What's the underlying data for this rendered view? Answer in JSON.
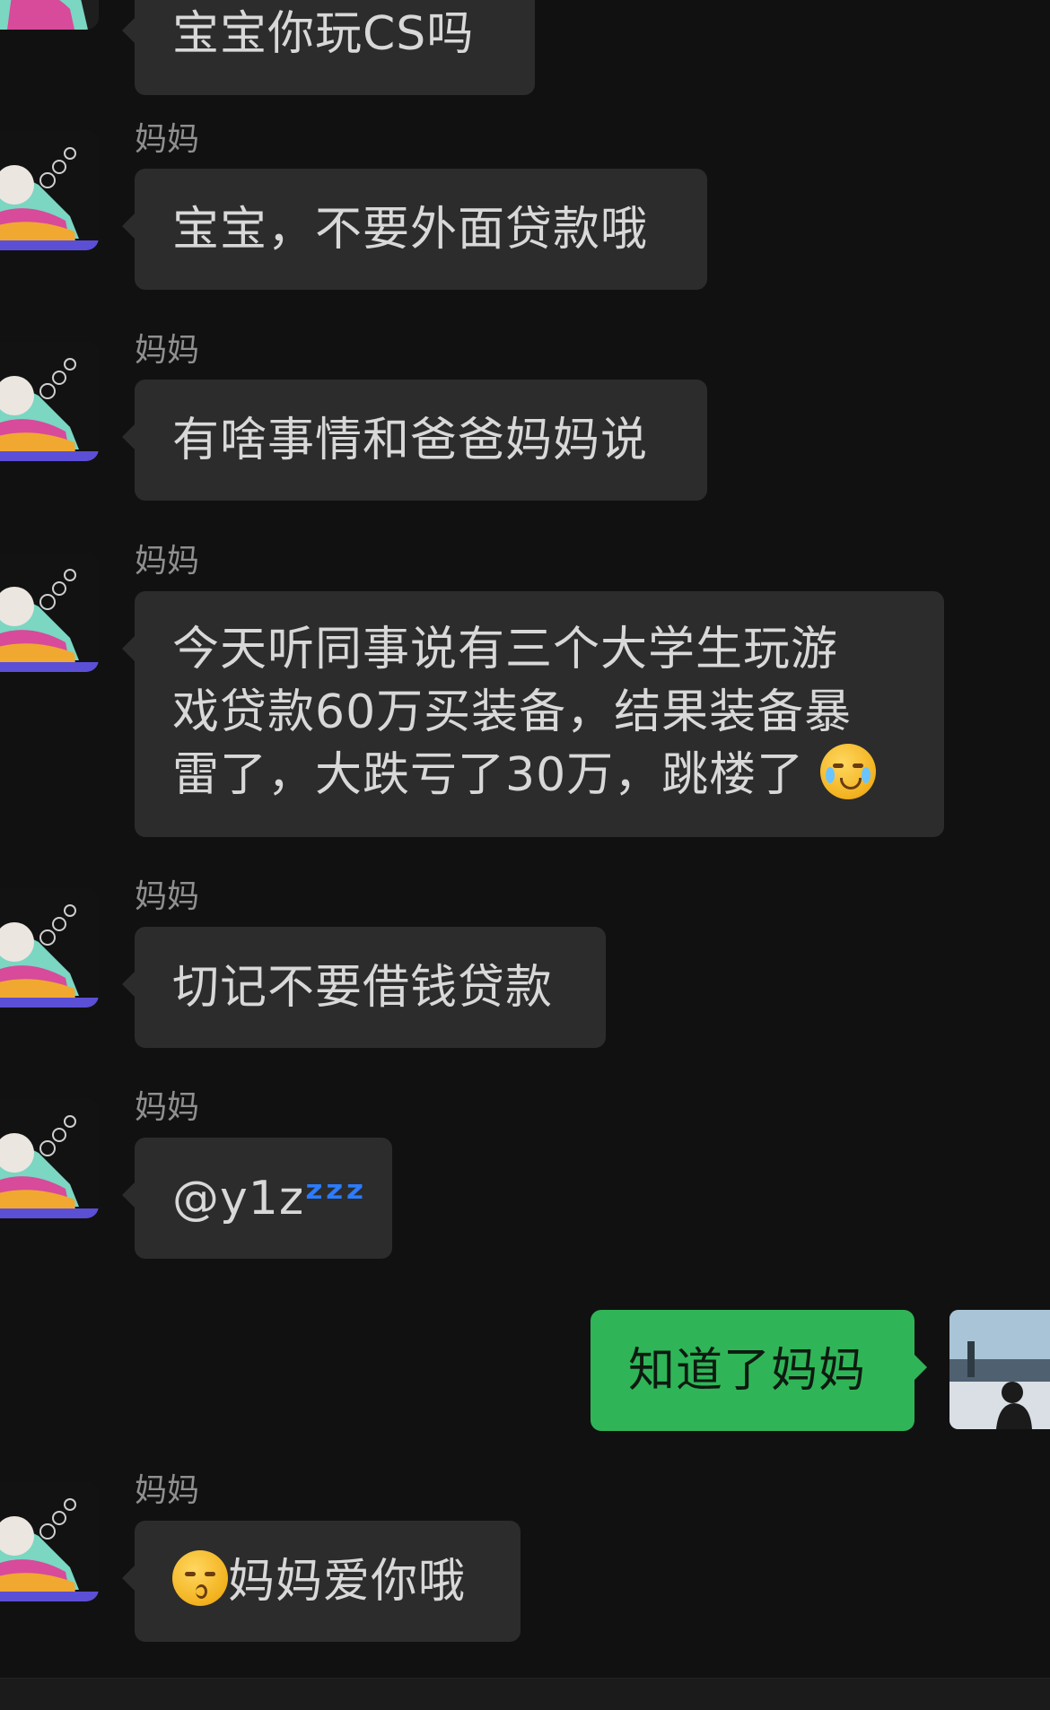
{
  "contact_name": "妈妈",
  "messages": [
    {
      "sender": "妈妈",
      "text": "宝宝你玩CS吗"
    },
    {
      "sender": "妈妈",
      "text": "宝宝，不要外面贷款哦"
    },
    {
      "sender": "妈妈",
      "text": "有啥事情和爸爸妈妈说"
    },
    {
      "sender": "妈妈",
      "line1": "今天听同事说有三个大学生玩游",
      "line2": "戏贷款60万买装备，结果装备暴",
      "line3": "雷了，大跌亏了30万，跳楼了",
      "emoji": "loudly-crying-face"
    },
    {
      "sender": "妈妈",
      "text": "切记不要借钱贷款"
    },
    {
      "sender": "妈妈",
      "mention": "@y1z",
      "emoji_text": "ᶻᶻᶻ",
      "emoji": "sleeping-symbol"
    },
    {
      "sender": "me",
      "text": "知道了妈妈"
    },
    {
      "sender": "妈妈",
      "text": "妈妈爱你哦",
      "emoji": "kissing-face"
    }
  ],
  "colors": {
    "background": "#111111",
    "received_bubble": "#2c2c2c",
    "sent_bubble": "#2fb558",
    "name_text": "#8f8f8f"
  }
}
